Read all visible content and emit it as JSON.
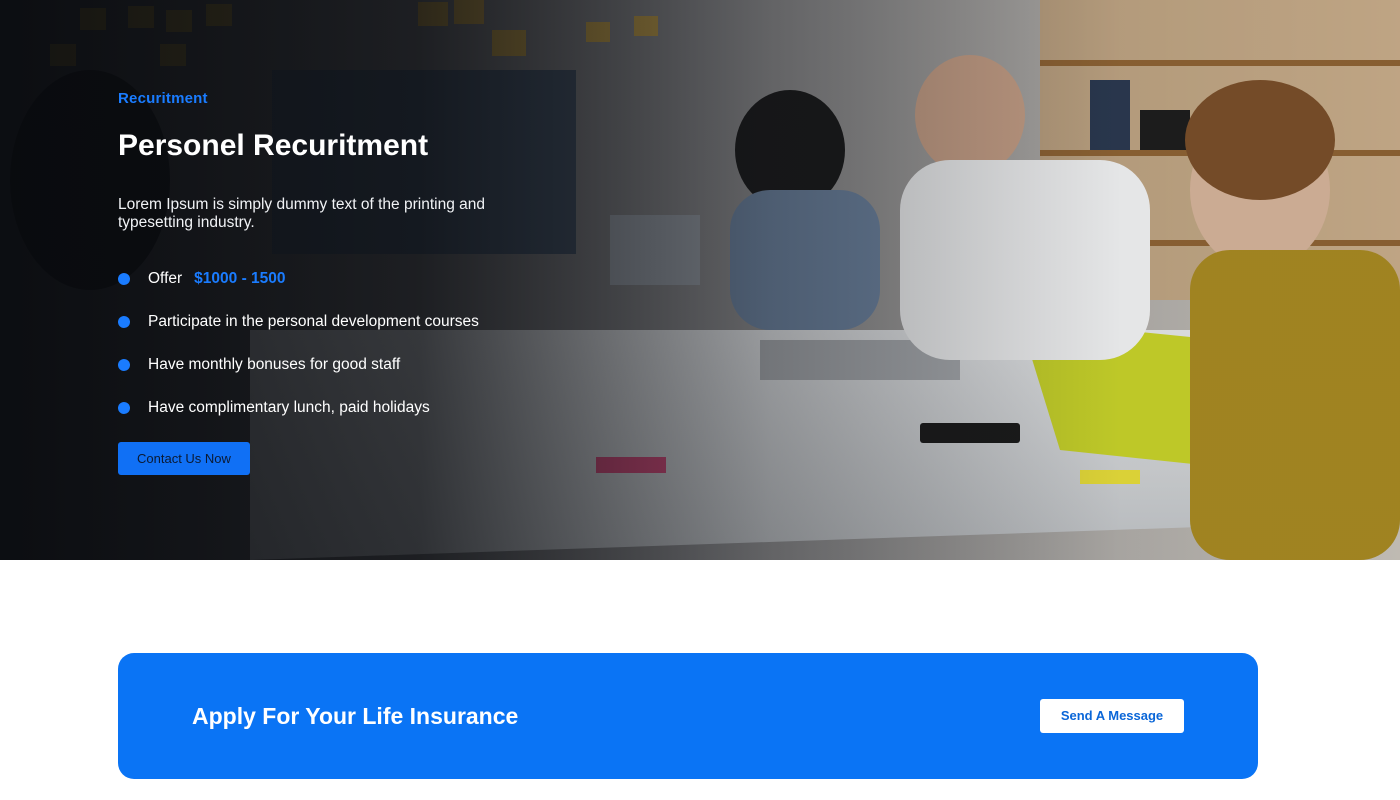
{
  "hero": {
    "eyebrow": "Recuritment",
    "title": "Personel Recuritment",
    "description": "Lorem Ipsum is simply dummy text of the printing and typesetting industry.",
    "offer": {
      "label": "Offer",
      "value": "$1000 - 1500"
    },
    "features": [
      "Participate in the personal development courses",
      "Have monthly bonuses for good staff",
      "Have complimentary lunch, paid holidays"
    ],
    "contact_button_label": "Contact Us Now"
  },
  "cta": {
    "title": "Apply For Your Life Insurance",
    "button_label": "Send A Message"
  },
  "colors": {
    "accent_blue": "#1a7cff",
    "cta_background": "#0a74f5",
    "white": "#ffffff"
  },
  "icons": {
    "bullet": "bullet-dot-icon"
  }
}
